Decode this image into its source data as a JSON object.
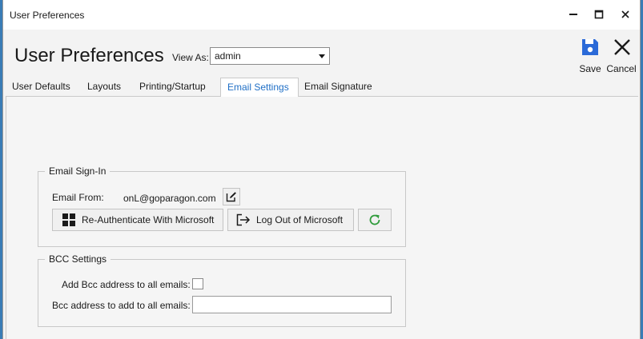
{
  "window": {
    "title": "User Preferences"
  },
  "header": {
    "title": "User Preferences",
    "view_as_label": "View As:",
    "view_as_value": "admin"
  },
  "toolbar": {
    "save_label": "Save",
    "cancel_label": "Cancel"
  },
  "tabs": [
    {
      "label": "User Defaults",
      "active": false
    },
    {
      "label": "Layouts",
      "active": false
    },
    {
      "label": "Printing/Startup",
      "active": false
    },
    {
      "label": "Email Settings",
      "active": true
    },
    {
      "label": "Email Signature",
      "active": false
    }
  ],
  "email_signin": {
    "legend": "Email Sign-In",
    "email_from_label": "Email From:",
    "email_from_value": "onL@goparagon.com",
    "reauth_label": "Re-Authenticate With Microsoft",
    "logout_label": "Log Out of Microsoft"
  },
  "bcc_settings": {
    "legend": "BCC Settings",
    "add_bcc_label": "Add Bcc address to all emails:",
    "add_bcc_checked": false,
    "bcc_address_label": "Bcc address to add to all emails:",
    "bcc_address_value": ""
  },
  "colors": {
    "accent": "#1f6fc6",
    "save_icon": "#2b6ad8",
    "refresh_icon": "#2e9b3a"
  },
  "icons": {
    "edit": "edit-icon",
    "microsoft": "microsoft-logo-icon",
    "logout": "logout-icon",
    "refresh": "refresh-icon",
    "save": "save-icon",
    "cancel": "close-icon"
  }
}
